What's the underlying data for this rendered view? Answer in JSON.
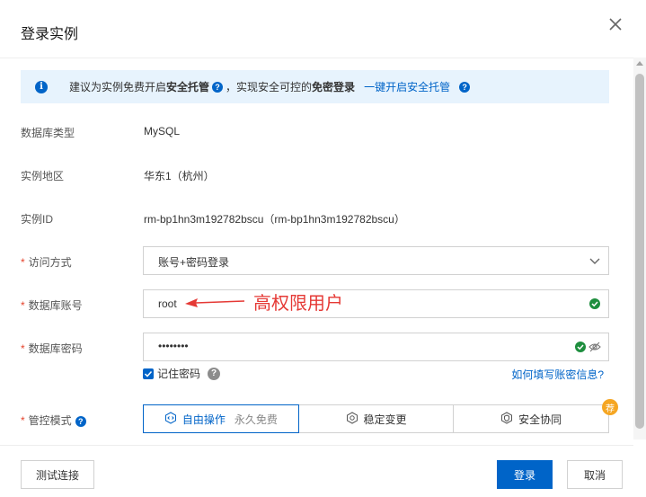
{
  "dialog": {
    "title": "登录实例"
  },
  "banner": {
    "text1": "建议为实例免费开启",
    "bold1": "安全托管",
    "text2": "，实现安全可控的",
    "bold2": "免密登录",
    "link": "一键开启安全托管"
  },
  "fields": {
    "db_type": {
      "label": "数据库类型",
      "value": "MySQL"
    },
    "region": {
      "label": "实例地区",
      "value": "华东1（杭州）"
    },
    "instance_id": {
      "label": "实例ID",
      "value": "rm-bp1hn3m192782bscu（rm-bp1hn3m192782bscu）"
    },
    "access_mode": {
      "label": "访问方式",
      "value": "账号+密码登录"
    },
    "account": {
      "label": "数据库账号",
      "value": "root"
    },
    "password": {
      "label": "数据库密码",
      "value": "••••••••"
    }
  },
  "remember": {
    "label": "记住密码",
    "checked": true
  },
  "help_link": "如何填写账密信息?",
  "control_mode": {
    "label": "管控模式",
    "options": [
      {
        "label": "自由操作",
        "sub": "永久免费",
        "active": true
      },
      {
        "label": "稳定变更"
      },
      {
        "label": "安全协同"
      }
    ],
    "badge": "荐"
  },
  "annotation": "高权限用户",
  "footer": {
    "test_label": "测试连接",
    "login_label": "登录",
    "cancel_label": "取消"
  },
  "colors": {
    "primary": "#0064c8",
    "required": "#e5432c",
    "annotation": "#e53935",
    "success": "#1e8e3e",
    "badge": "#f5a623"
  }
}
